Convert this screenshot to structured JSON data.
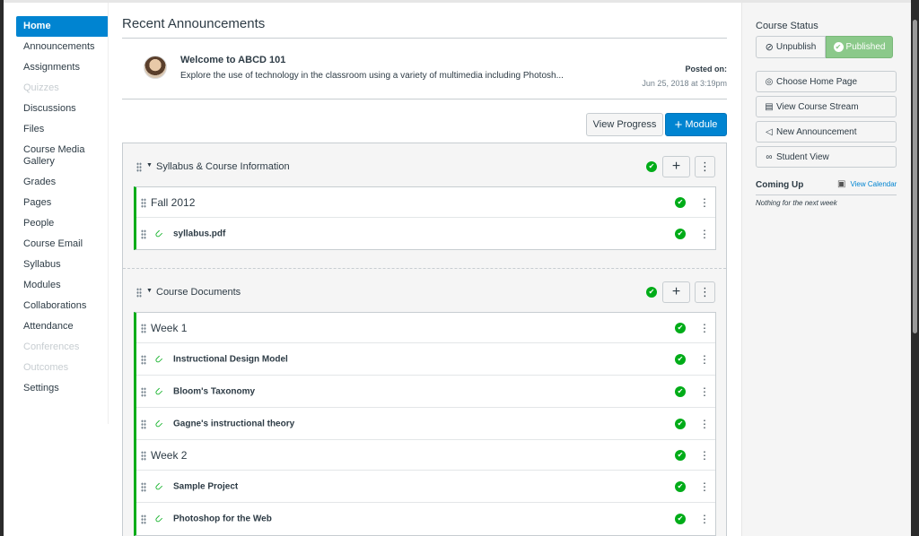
{
  "nav": {
    "items": [
      {
        "label": "Home",
        "state": "active"
      },
      {
        "label": "Announcements",
        "state": "normal"
      },
      {
        "label": "Assignments",
        "state": "normal"
      },
      {
        "label": "Quizzes",
        "state": "disabled"
      },
      {
        "label": "Discussions",
        "state": "normal"
      },
      {
        "label": "Files",
        "state": "normal"
      },
      {
        "label": "Course Media Gallery",
        "state": "normal"
      },
      {
        "label": "Grades",
        "state": "normal"
      },
      {
        "label": "Pages",
        "state": "normal"
      },
      {
        "label": "People",
        "state": "normal"
      },
      {
        "label": "Course Email",
        "state": "normal"
      },
      {
        "label": "Syllabus",
        "state": "normal"
      },
      {
        "label": "Modules",
        "state": "normal"
      },
      {
        "label": "Collaborations",
        "state": "normal"
      },
      {
        "label": "Attendance",
        "state": "normal"
      },
      {
        "label": "Conferences",
        "state": "disabled"
      },
      {
        "label": "Outcomes",
        "state": "disabled"
      },
      {
        "label": "Settings",
        "state": "normal"
      }
    ]
  },
  "announcements": {
    "heading": "Recent Announcements",
    "item": {
      "title": "Welcome to ABCD 101",
      "excerpt": "Explore the use of technology in the classroom using a variety of multimedia including Photosh...",
      "posted_label": "Posted on:",
      "posted_date": "Jun 25, 2018 at 3:19pm"
    }
  },
  "actions": {
    "view_progress": "View Progress",
    "module": "Module"
  },
  "modules": [
    {
      "name": "Syllabus & Course Information",
      "items": [
        {
          "type": "subheader",
          "label": "Fall 2012"
        },
        {
          "type": "attachment",
          "label": "syllabus.pdf"
        }
      ]
    },
    {
      "name": "Course Documents",
      "items": [
        {
          "type": "subheader",
          "label": "Week 1"
        },
        {
          "type": "attachment",
          "label": "Instructional Design Model"
        },
        {
          "type": "attachment",
          "label": "Bloom's Taxonomy"
        },
        {
          "type": "attachment",
          "label": "Gagne's instructional theory"
        },
        {
          "type": "subheader",
          "label": "Week 2"
        },
        {
          "type": "attachment",
          "label": "Sample Project"
        },
        {
          "type": "attachment",
          "label": "Photoshop for the Web"
        }
      ]
    }
  ],
  "sidebar": {
    "course_status": "Course Status",
    "unpublish": "Unpublish",
    "published": "Published",
    "buttons": [
      {
        "label": "Choose Home Page",
        "icon": "target-icon"
      },
      {
        "label": "View Course Stream",
        "icon": "stream-icon"
      },
      {
        "label": "New Announcement",
        "icon": "megaphone-icon"
      },
      {
        "label": "Student View",
        "icon": "glasses-icon"
      }
    ],
    "coming_up": "Coming Up",
    "view_calendar": "View Calendar",
    "nothing": "Nothing for the next week"
  },
  "colors": {
    "accent": "#0084d1",
    "published": "#00ac18",
    "published_button": "#8bc98a"
  }
}
